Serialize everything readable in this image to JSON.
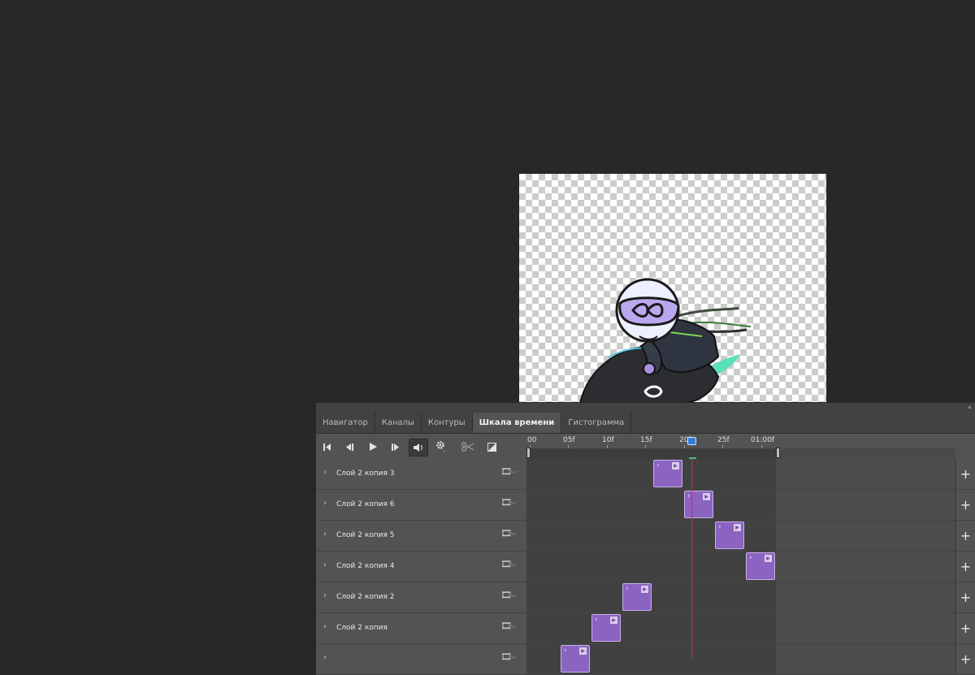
{
  "panel": {
    "tabs": [
      {
        "label": "Навигатор",
        "active": false
      },
      {
        "label": "Каналы",
        "active": false
      },
      {
        "label": "Контуры",
        "active": false
      },
      {
        "label": "Шкала времени",
        "active": true
      },
      {
        "label": "Гистограмма",
        "active": false
      }
    ],
    "collapse_icon": "«"
  },
  "controls": {
    "first_frame_icon": "first-frame",
    "prev_frame_icon": "previous-frame",
    "play_icon": "play",
    "next_frame_icon": "next-frame",
    "audio_icon": "speaker",
    "settings_icon": "gear",
    "split_icon": "scissors",
    "transition_icon": "transition"
  },
  "ruler": {
    "labels": [
      "00",
      "05f",
      "10f",
      "15f",
      "20f",
      "25f",
      "01:00f"
    ],
    "playhead_frame": 21
  },
  "layers": [
    {
      "name": "Слой 2 копия 3",
      "clip_start_frame": 16
    },
    {
      "name": "Слой 2 копия 6",
      "clip_start_frame": 20
    },
    {
      "name": "Слой 2 копия 5",
      "clip_start_frame": 24
    },
    {
      "name": "Слой 2 копия 4",
      "clip_start_frame": 28
    },
    {
      "name": "Слой 2 копия 2",
      "clip_start_frame": 12
    },
    {
      "name": "Слой 2 копия",
      "clip_start_frame": 8
    },
    {
      "name": "",
      "clip_start_frame": 4
    }
  ],
  "glyphs": {
    "chevron_right": "›",
    "dropdown": "⌵",
    "film": "🎞",
    "plus": "+",
    "clip_chevron": "›",
    "clip_play": "▶"
  },
  "colors": {
    "clip_fill": "#8b63c0",
    "playhead": "#d13030",
    "playhead_marker": "#2f7fd8"
  }
}
